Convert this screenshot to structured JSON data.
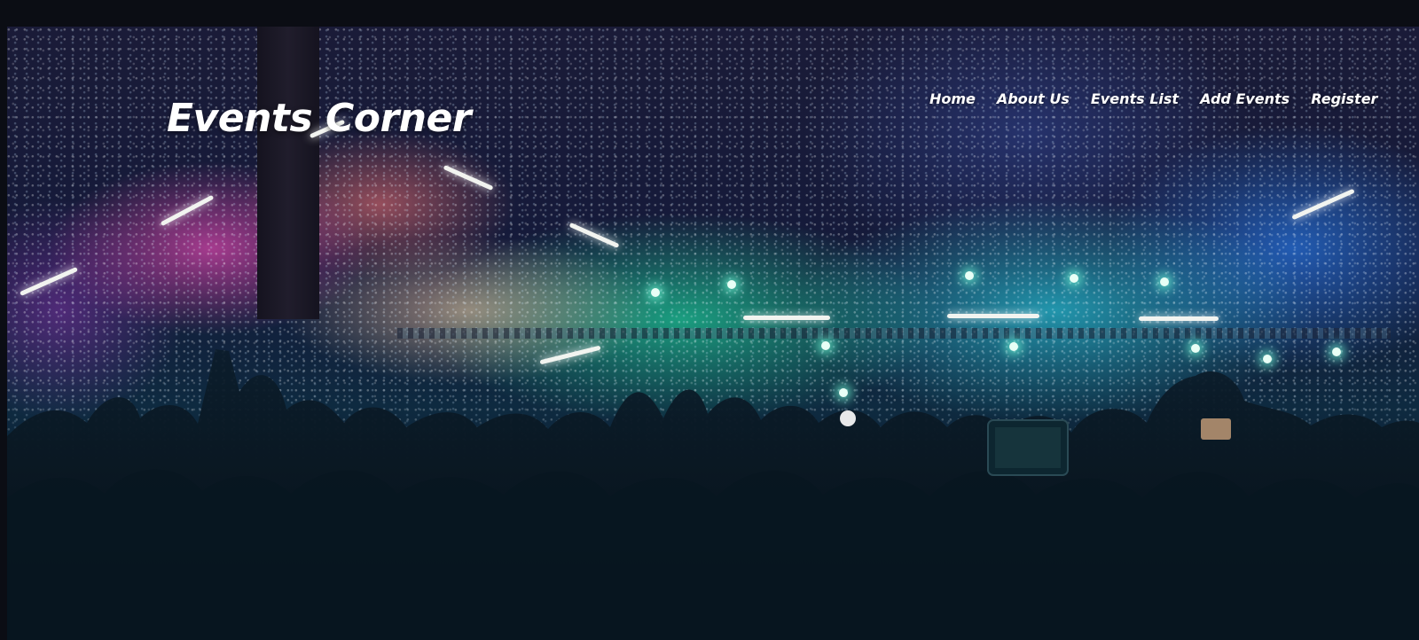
{
  "site": {
    "title": "Events Corner"
  },
  "nav": {
    "items": [
      {
        "label": "Home"
      },
      {
        "label": "About Us"
      },
      {
        "label": "Events List"
      },
      {
        "label": "Add Events"
      },
      {
        "label": "Register"
      }
    ]
  },
  "hero": {
    "image": "concert-crowd-stage-lights",
    "colors": {
      "magenta": "#d646aa",
      "teal": "#1ec896",
      "cyan": "#28c8dc",
      "blue": "#2878e6",
      "text": "#ffffff"
    }
  }
}
